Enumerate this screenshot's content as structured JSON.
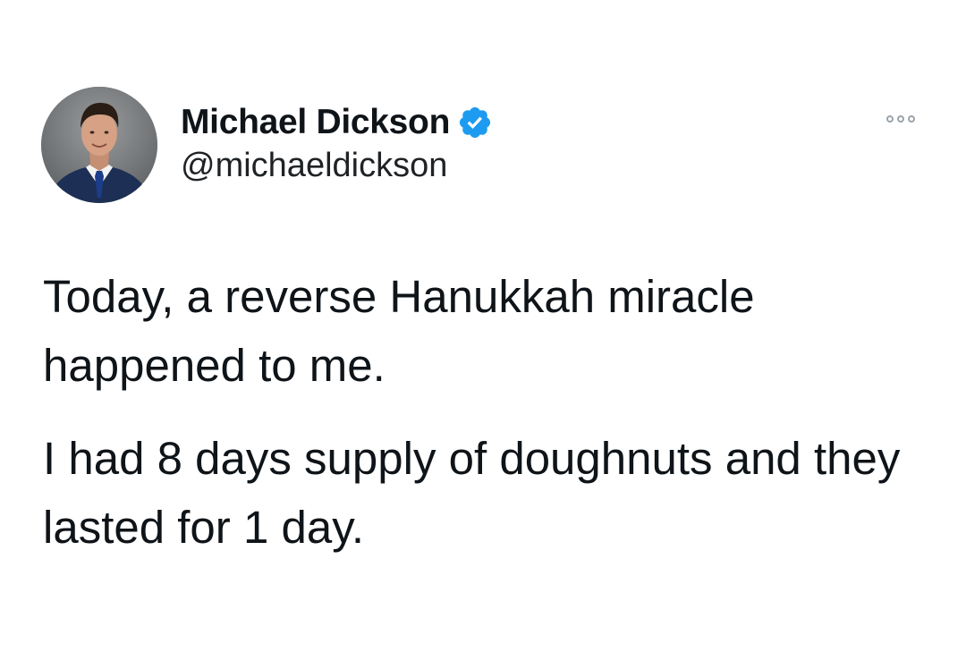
{
  "author": {
    "display_name": "Michael Dickson",
    "handle": "@michaeldickson",
    "verified": true
  },
  "tweet": {
    "paragraphs": [
      "Today, a reverse Hanukkah miracle happened to me.",
      "I had 8 days supply of doughnuts and they lasted for 1 day."
    ]
  },
  "icons": {
    "verified": "verified-badge-icon",
    "more": "more-options-icon"
  },
  "colors": {
    "verified_blue": "#1d9bf0",
    "text": "#0f1419",
    "more_dots": "#9aa3ab"
  }
}
